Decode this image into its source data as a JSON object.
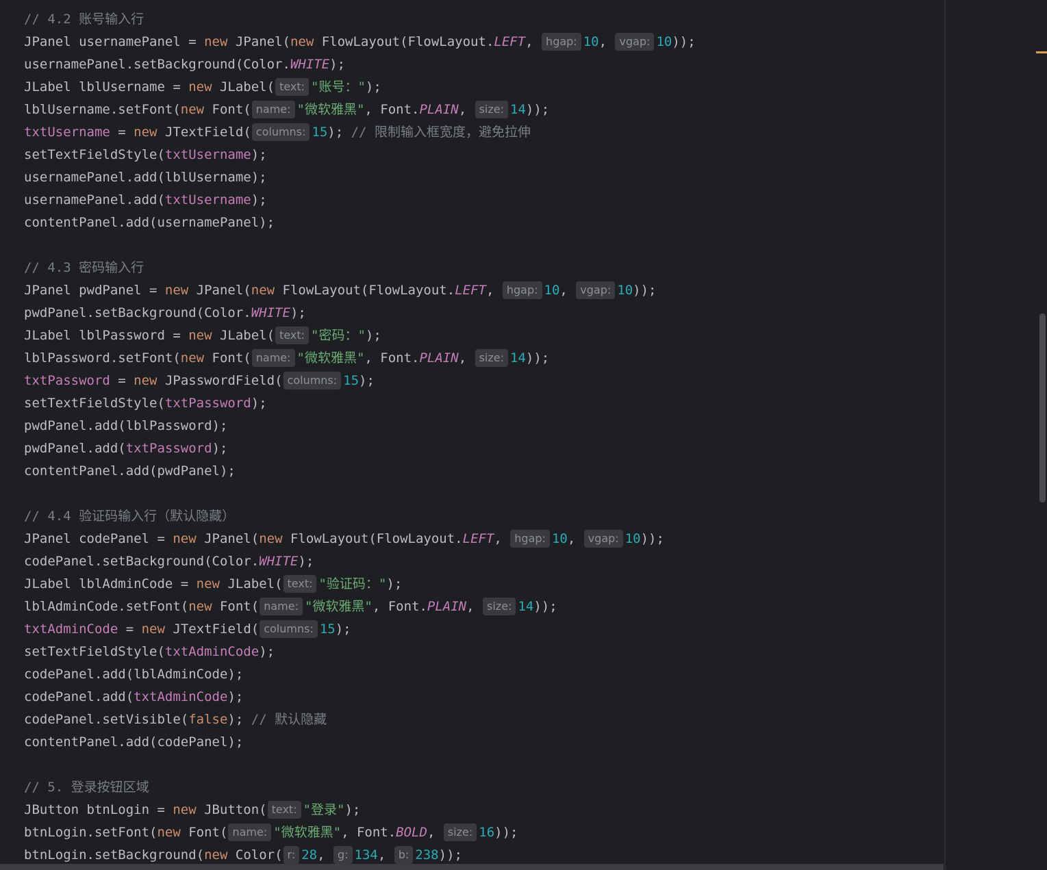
{
  "editor": {
    "language": "Java",
    "theme_colors": {
      "background": "#1e1f22",
      "default_text": "#bcbec4",
      "keyword": "#cf8e6d",
      "field": "#c77dbb",
      "constant": "#c77dbb",
      "number": "#2aacb8",
      "string": "#6aab73",
      "comment": "#7a7e85",
      "hint_background": "#393b40",
      "hint_text": "#8c8f94",
      "scroll_marker": "#e0a04b"
    },
    "lines": [
      [
        [
          "cmt",
          "// 4.2 账号输入行"
        ]
      ],
      [
        [
          "",
          "JPanel usernamePanel = "
        ],
        [
          "kw",
          "new"
        ],
        [
          "",
          " JPanel("
        ],
        [
          "kw",
          "new"
        ],
        [
          "",
          " FlowLayout(FlowLayout."
        ],
        [
          "const",
          "LEFT"
        ],
        [
          "",
          ", "
        ],
        [
          "hint",
          "hgap:"
        ],
        [
          "num",
          "10"
        ],
        [
          "",
          ", "
        ],
        [
          "hint",
          "vgap:"
        ],
        [
          "num",
          "10"
        ],
        [
          "",
          "));"
        ]
      ],
      [
        [
          "",
          "usernamePanel.setBackground(Color."
        ],
        [
          "const",
          "WHITE"
        ],
        [
          "",
          ");"
        ]
      ],
      [
        [
          "",
          "JLabel lblUsername = "
        ],
        [
          "kw",
          "new"
        ],
        [
          "",
          " JLabel("
        ],
        [
          "hint",
          "text:"
        ],
        [
          "str",
          "\"账号：\""
        ],
        [
          "",
          ");"
        ]
      ],
      [
        [
          "",
          "lblUsername.setFont("
        ],
        [
          "kw",
          "new"
        ],
        [
          "",
          " Font("
        ],
        [
          "hint",
          "name:"
        ],
        [
          "str",
          "\"微软雅黑\""
        ],
        [
          "",
          ", Font."
        ],
        [
          "const",
          "PLAIN"
        ],
        [
          "",
          ", "
        ],
        [
          "hint",
          "size:"
        ],
        [
          "num",
          "14"
        ],
        [
          "",
          "));"
        ]
      ],
      [
        [
          "field",
          "txtUsername"
        ],
        [
          "",
          " = "
        ],
        [
          "kw",
          "new"
        ],
        [
          "",
          " JTextField("
        ],
        [
          "hint",
          "columns:"
        ],
        [
          "num",
          "15"
        ],
        [
          "",
          "); "
        ],
        [
          "cmt",
          "// 限制输入框宽度，避免拉伸"
        ]
      ],
      [
        [
          "",
          "setTextFieldStyle("
        ],
        [
          "field",
          "txtUsername"
        ],
        [
          "",
          ");"
        ]
      ],
      [
        [
          "",
          "usernamePanel.add(lblUsername);"
        ]
      ],
      [
        [
          "",
          "usernamePanel.add("
        ],
        [
          "field",
          "txtUsername"
        ],
        [
          "",
          ");"
        ]
      ],
      [
        [
          "",
          "contentPanel.add(usernamePanel);"
        ]
      ],
      [],
      [
        [
          "cmt",
          "// 4.3 密码输入行"
        ]
      ],
      [
        [
          "",
          "JPanel pwdPanel = "
        ],
        [
          "kw",
          "new"
        ],
        [
          "",
          " JPanel("
        ],
        [
          "kw",
          "new"
        ],
        [
          "",
          " FlowLayout(FlowLayout."
        ],
        [
          "const",
          "LEFT"
        ],
        [
          "",
          ", "
        ],
        [
          "hint",
          "hgap:"
        ],
        [
          "num",
          "10"
        ],
        [
          "",
          ", "
        ],
        [
          "hint",
          "vgap:"
        ],
        [
          "num",
          "10"
        ],
        [
          "",
          "));"
        ]
      ],
      [
        [
          "",
          "pwdPanel.setBackground(Color."
        ],
        [
          "const",
          "WHITE"
        ],
        [
          "",
          ");"
        ]
      ],
      [
        [
          "",
          "JLabel lblPassword = "
        ],
        [
          "kw",
          "new"
        ],
        [
          "",
          " JLabel("
        ],
        [
          "hint",
          "text:"
        ],
        [
          "str",
          "\"密码：\""
        ],
        [
          "",
          ");"
        ]
      ],
      [
        [
          "",
          "lblPassword.setFont("
        ],
        [
          "kw",
          "new"
        ],
        [
          "",
          " Font("
        ],
        [
          "hint",
          "name:"
        ],
        [
          "str",
          "\"微软雅黑\""
        ],
        [
          "",
          ", Font."
        ],
        [
          "const",
          "PLAIN"
        ],
        [
          "",
          ", "
        ],
        [
          "hint",
          "size:"
        ],
        [
          "num",
          "14"
        ],
        [
          "",
          "));"
        ]
      ],
      [
        [
          "field",
          "txtPassword"
        ],
        [
          "",
          " = "
        ],
        [
          "kw",
          "new"
        ],
        [
          "",
          " JPasswordField("
        ],
        [
          "hint",
          "columns:"
        ],
        [
          "num",
          "15"
        ],
        [
          "",
          ");"
        ]
      ],
      [
        [
          "",
          "setTextFieldStyle("
        ],
        [
          "field",
          "txtPassword"
        ],
        [
          "",
          ");"
        ]
      ],
      [
        [
          "",
          "pwdPanel.add(lblPassword);"
        ]
      ],
      [
        [
          "",
          "pwdPanel.add("
        ],
        [
          "field",
          "txtPassword"
        ],
        [
          "",
          ");"
        ]
      ],
      [
        [
          "",
          "contentPanel.add(pwdPanel);"
        ]
      ],
      [],
      [
        [
          "cmt",
          "// 4.4 验证码输入行（默认隐藏）"
        ]
      ],
      [
        [
          "",
          "JPanel codePanel = "
        ],
        [
          "kw",
          "new"
        ],
        [
          "",
          " JPanel("
        ],
        [
          "kw",
          "new"
        ],
        [
          "",
          " FlowLayout(FlowLayout."
        ],
        [
          "const",
          "LEFT"
        ],
        [
          "",
          ", "
        ],
        [
          "hint",
          "hgap:"
        ],
        [
          "num",
          "10"
        ],
        [
          "",
          ", "
        ],
        [
          "hint",
          "vgap:"
        ],
        [
          "num",
          "10"
        ],
        [
          "",
          "));"
        ]
      ],
      [
        [
          "",
          "codePanel.setBackground(Color."
        ],
        [
          "const",
          "WHITE"
        ],
        [
          "",
          ");"
        ]
      ],
      [
        [
          "",
          "JLabel lblAdminCode = "
        ],
        [
          "kw",
          "new"
        ],
        [
          "",
          " JLabel("
        ],
        [
          "hint",
          "text:"
        ],
        [
          "str",
          "\"验证码：\""
        ],
        [
          "",
          ");"
        ]
      ],
      [
        [
          "",
          "lblAdminCode.setFont("
        ],
        [
          "kw",
          "new"
        ],
        [
          "",
          " Font("
        ],
        [
          "hint",
          "name:"
        ],
        [
          "str",
          "\"微软雅黑\""
        ],
        [
          "",
          ", Font."
        ],
        [
          "const",
          "PLAIN"
        ],
        [
          "",
          ", "
        ],
        [
          "hint",
          "size:"
        ],
        [
          "num",
          "14"
        ],
        [
          "",
          "));"
        ]
      ],
      [
        [
          "field",
          "txtAdminCode"
        ],
        [
          "",
          " = "
        ],
        [
          "kw",
          "new"
        ],
        [
          "",
          " JTextField("
        ],
        [
          "hint",
          "columns:"
        ],
        [
          "num",
          "15"
        ],
        [
          "",
          ");"
        ]
      ],
      [
        [
          "",
          "setTextFieldStyle("
        ],
        [
          "field",
          "txtAdminCode"
        ],
        [
          "",
          ");"
        ]
      ],
      [
        [
          "",
          "codePanel.add(lblAdminCode);"
        ]
      ],
      [
        [
          "",
          "codePanel.add("
        ],
        [
          "field",
          "txtAdminCode"
        ],
        [
          "",
          ");"
        ]
      ],
      [
        [
          "",
          "codePanel.setVisible("
        ],
        [
          "kw",
          "false"
        ],
        [
          "",
          "); "
        ],
        [
          "cmt",
          "// 默认隐藏"
        ]
      ],
      [
        [
          "",
          "contentPanel.add(codePanel);"
        ]
      ],
      [],
      [
        [
          "cmt",
          "// 5. 登录按钮区域"
        ]
      ],
      [
        [
          "",
          "JButton btnLogin = "
        ],
        [
          "kw",
          "new"
        ],
        [
          "",
          " JButton("
        ],
        [
          "hint",
          "text:"
        ],
        [
          "str",
          "\"登录\""
        ],
        [
          "",
          ");"
        ]
      ],
      [
        [
          "",
          "btnLogin.setFont("
        ],
        [
          "kw",
          "new"
        ],
        [
          "",
          " Font("
        ],
        [
          "hint",
          "name:"
        ],
        [
          "str",
          "\"微软雅黑\""
        ],
        [
          "",
          ", Font."
        ],
        [
          "const",
          "BOLD"
        ],
        [
          "",
          ", "
        ],
        [
          "hint",
          "size:"
        ],
        [
          "num",
          "16"
        ],
        [
          "",
          "));"
        ]
      ],
      [
        [
          "",
          "btnLogin.setBackground("
        ],
        [
          "kw",
          "new"
        ],
        [
          "",
          " Color("
        ],
        [
          "hint",
          "r:"
        ],
        [
          "num",
          "28"
        ],
        [
          "",
          ", "
        ],
        [
          "hint",
          "g:"
        ],
        [
          "num",
          "134"
        ],
        [
          "",
          ", "
        ],
        [
          "hint",
          "b:"
        ],
        [
          "num",
          "238"
        ],
        [
          "",
          "));"
        ]
      ]
    ]
  }
}
